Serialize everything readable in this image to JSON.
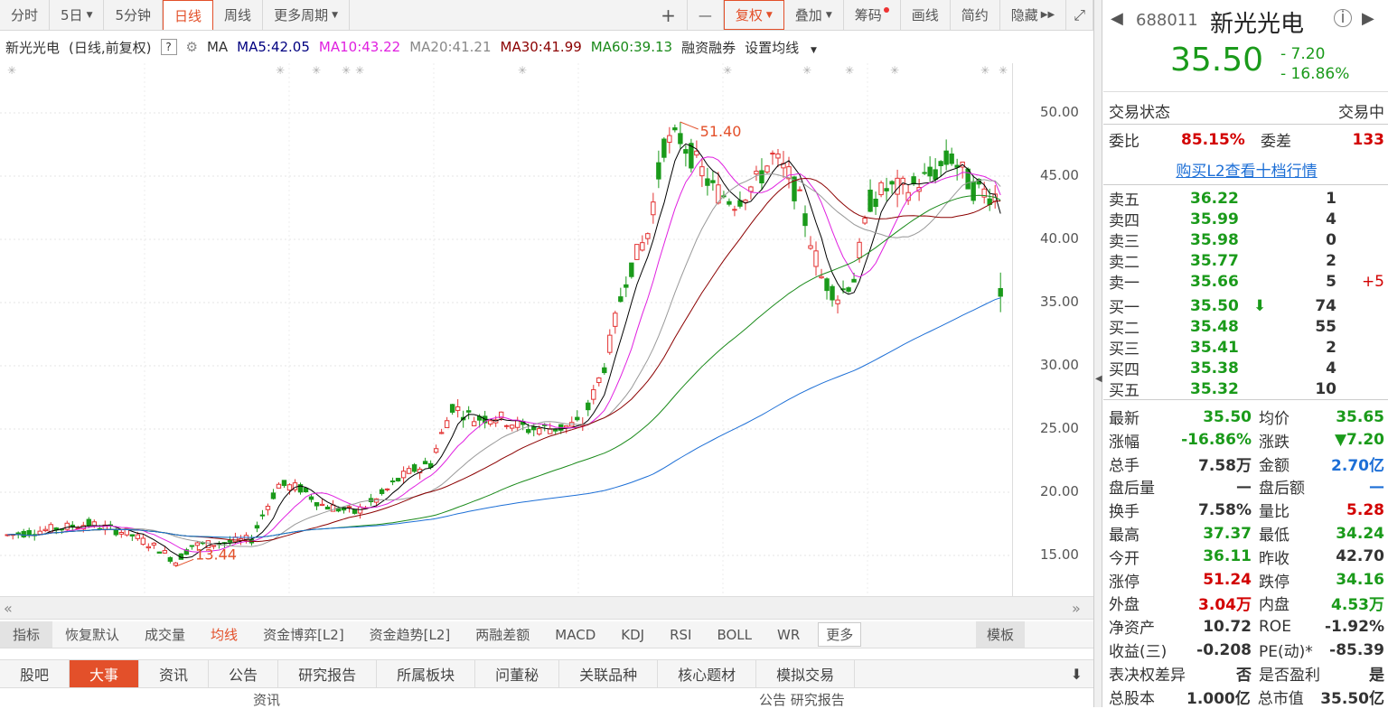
{
  "toolbar": {
    "periods": [
      "分时",
      "5日",
      "5分钟",
      "日线",
      "周线",
      "更多周期"
    ],
    "active_period": "日线",
    "tools": [
      "+",
      "—",
      "复权",
      "叠加",
      "筹码",
      "画线",
      "简约",
      "隐藏"
    ]
  },
  "legend": {
    "name": "新光光电",
    "mode": "(日线,前复权)",
    "help": "?",
    "ma": "MA",
    "ma5": "MA5:42.05",
    "ma10": "MA10:43.22",
    "ma20": "MA20:41.21",
    "ma30": "MA30:41.99",
    "ma60": "MA60:39.13",
    "margin": "融资融券",
    "setting": "设置均线"
  },
  "chart_data": {
    "type": "candlestick",
    "y_ticks": [
      "50.00",
      "45.00",
      "40.00",
      "35.00",
      "30.00",
      "25.00",
      "20.00",
      "15.00"
    ],
    "high_label": "51.40",
    "low_label": "13.44",
    "colors": {
      "up": "#e33333",
      "down": "#1a9a1a",
      "ma5": "#000000",
      "ma10": "#e020e0",
      "ma20": "#999999",
      "ma30": "#8b0000",
      "ma60": "#1a8a1a",
      "ma120": "#1d6fd6"
    }
  },
  "indicator_tabs": [
    "指标",
    "恢复默认",
    "成交量",
    "均线",
    "资金博弈[L2]",
    "资金趋势[L2]",
    "两融差额",
    "MACD",
    "KDJ",
    "RSI",
    "BOLL",
    "WR",
    "更多",
    "模板"
  ],
  "bottom_tabs": [
    "股吧",
    "大事",
    "资讯",
    "公告",
    "研究报告",
    "所属板块",
    "问董秘",
    "关联品种",
    "核心题材",
    "模拟交易"
  ],
  "bottom_labels": [
    "资讯",
    "公告 研究报告"
  ],
  "panel": {
    "code": "688011",
    "name": "新光光电",
    "price": "35.50",
    "change": "- 7.20",
    "pct": "- 16.86%",
    "trade_status_label": "交易状态",
    "trade_status": "交易中",
    "weibi_label": "委比",
    "weibi": "85.15%",
    "weicha_label": "委差",
    "weicha": "133",
    "l2_link": "购买L2查看十档行情",
    "asks": [
      {
        "label": "卖五",
        "price": "36.22",
        "vol": "1",
        "chg": ""
      },
      {
        "label": "卖四",
        "price": "35.99",
        "vol": "4",
        "chg": ""
      },
      {
        "label": "卖三",
        "price": "35.98",
        "vol": "0",
        "chg": ""
      },
      {
        "label": "卖二",
        "price": "35.77",
        "vol": "2",
        "chg": ""
      },
      {
        "label": "卖一",
        "price": "35.66",
        "vol": "5",
        "chg": "+5"
      }
    ],
    "bids": [
      {
        "label": "买一",
        "price": "35.50",
        "vol": "74"
      },
      {
        "label": "买二",
        "price": "35.48",
        "vol": "55"
      },
      {
        "label": "买三",
        "price": "35.41",
        "vol": "2"
      },
      {
        "label": "买四",
        "price": "35.38",
        "vol": "4"
      },
      {
        "label": "买五",
        "price": "35.32",
        "vol": "10"
      }
    ],
    "stats": [
      {
        "l1": "最新",
        "v1": "35.50",
        "c1": "green",
        "l2": "均价",
        "v2": "35.65",
        "c2": "green"
      },
      {
        "l1": "涨幅",
        "v1": "-16.86%",
        "c1": "green",
        "l2": "涨跌",
        "v2": "▼7.20",
        "c2": "green"
      },
      {
        "l1": "总手",
        "v1": "7.58万",
        "c1": "",
        "l2": "金额",
        "v2": "2.70亿",
        "c2": "blue"
      },
      {
        "l1": "盘后量",
        "v1": "—",
        "c1": "",
        "l2": "盘后额",
        "v2": "—",
        "c2": "blue"
      },
      {
        "l1": "换手",
        "v1": "7.58%",
        "c1": "",
        "l2": "量比",
        "v2": "5.28",
        "c2": "red"
      },
      {
        "l1": "最高",
        "v1": "37.37",
        "c1": "green",
        "l2": "最低",
        "v2": "34.24",
        "c2": "green"
      },
      {
        "l1": "今开",
        "v1": "36.11",
        "c1": "green",
        "l2": "昨收",
        "v2": "42.70",
        "c2": ""
      },
      {
        "l1": "涨停",
        "v1": "51.24",
        "c1": "red",
        "l2": "跌停",
        "v2": "34.16",
        "c2": "green"
      },
      {
        "l1": "外盘",
        "v1": "3.04万",
        "c1": "red",
        "l2": "内盘",
        "v2": "4.53万",
        "c2": "green"
      },
      {
        "l1": "净资产",
        "v1": "10.72",
        "c1": "",
        "l2": "ROE",
        "v2": "-1.92%",
        "c2": ""
      },
      {
        "l1": "收益(三)",
        "v1": "-0.208",
        "c1": "",
        "l2": "PE(动)*",
        "v2": "-85.39",
        "c2": ""
      },
      {
        "l1": "表决权差异",
        "v1": "否",
        "c1": "",
        "l2": "是否盈利",
        "v2": "是",
        "c2": ""
      },
      {
        "l1": "总股本",
        "v1": "1.000亿",
        "c1": "",
        "l2": "总市值",
        "v2": "35.50亿",
        "c2": ""
      }
    ]
  }
}
